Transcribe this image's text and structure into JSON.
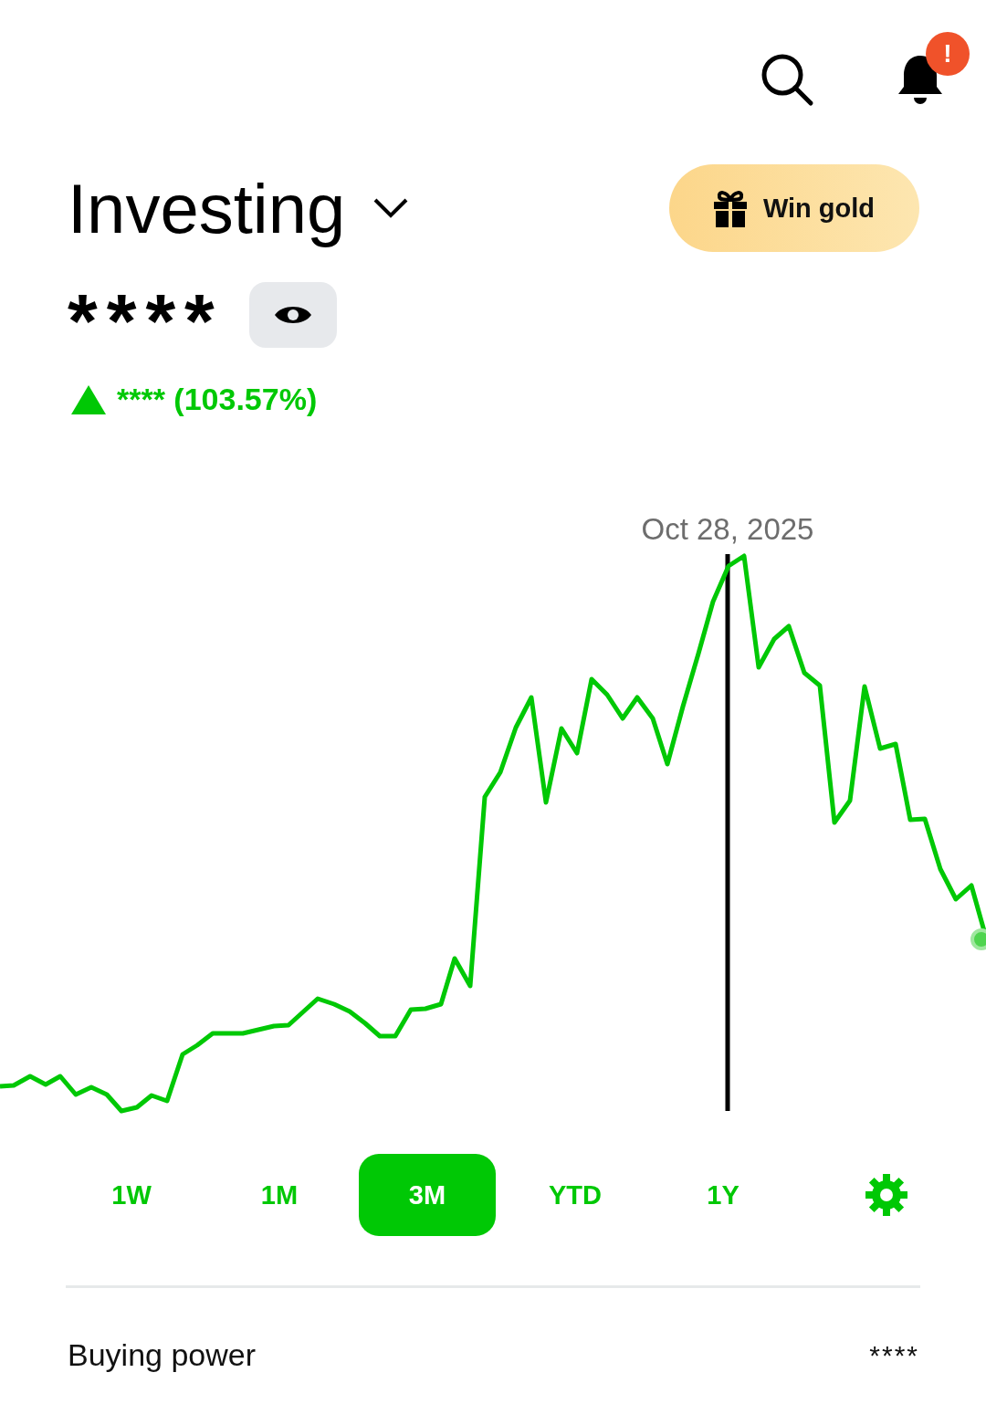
{
  "header": {
    "notification_badge": "!"
  },
  "account": {
    "title": "Investing",
    "win_button": "Win gold",
    "balance": "****",
    "change": {
      "rising": true,
      "text": "**** (103.57%)"
    }
  },
  "chart": {
    "cursor_date": "Oct 28, 2025"
  },
  "ranges": [
    {
      "label": "1W",
      "selected": false
    },
    {
      "label": "1M",
      "selected": false
    },
    {
      "label": "3M",
      "selected": true
    },
    {
      "label": "YTD",
      "selected": false
    },
    {
      "label": "1Y",
      "selected": false
    }
  ],
  "buying_power": {
    "label": "Buying power",
    "value": "****"
  }
}
